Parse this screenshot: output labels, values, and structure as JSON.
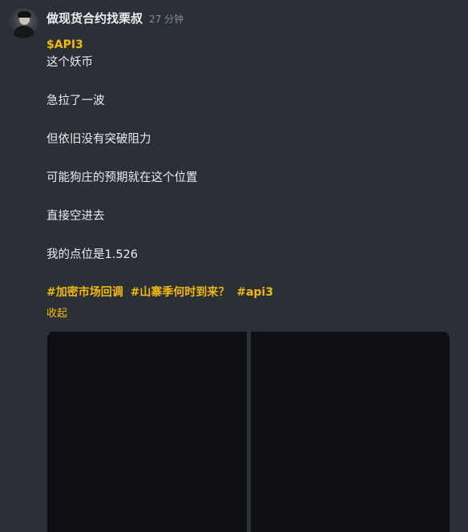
{
  "post": {
    "username": "做现货合约找栗叔",
    "timestamp": "27 分钟",
    "cashtag": "$API3",
    "lines": [
      "这个妖币",
      "急拉了一波",
      "但依旧没有突破阻力",
      "可能狗庄的预期就在这个位置",
      "直接空进去",
      "我的点位是1.526"
    ],
    "hashtags": [
      "#加密市场回调",
      "#山寨季何时到来？",
      "#api3"
    ],
    "collapse_label": "收起"
  },
  "colors": {
    "background": "#2b2f36",
    "accent": "#f0b90b",
    "text": "#eaecef",
    "muted": "#848e9c"
  }
}
